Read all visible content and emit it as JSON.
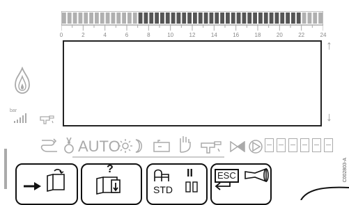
{
  "timeline": {
    "tick_labels": [
      "0",
      "2",
      "4",
      "6",
      "8",
      "10",
      "12",
      "14",
      "16",
      "18",
      "20",
      "22",
      "24"
    ],
    "hours": 24
  },
  "indicators": {
    "flame_icon": "flame-icon",
    "signal_label": "bar",
    "up_arrow": "↑",
    "down_arrow": "↓"
  },
  "mode_bar": {
    "auto_label": "AUTO"
  },
  "keys": {
    "std_label": "STD",
    "esc_label": "ESC",
    "pause_label": "II",
    "help_label": "?"
  },
  "side_code": "C002803-A",
  "colors": {
    "segment_off": "#b0b0b0",
    "segment_on": "#555555",
    "frame": "#111111"
  }
}
